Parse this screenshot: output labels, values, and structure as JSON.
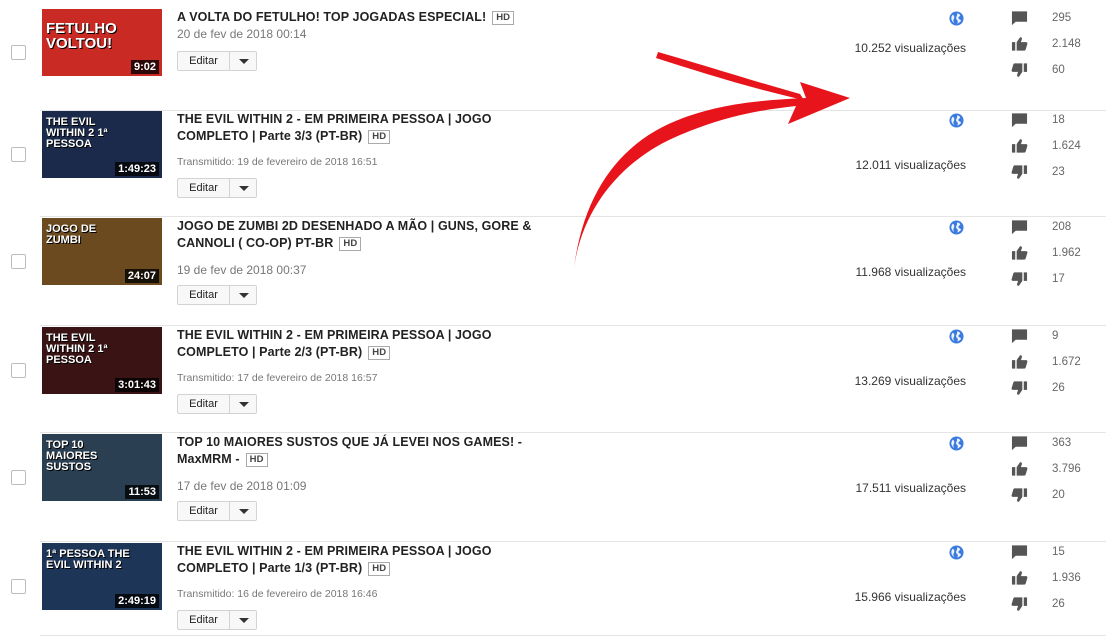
{
  "videos": [
    {
      "title": "A VOLTA DO FETULHO! TOP JOGADAS ESPECIAL!",
      "hd": "HD",
      "date": "20 de fev de 2018 00:14",
      "edit_label": "Editar",
      "views": "10.252 visualizações",
      "comments": "295",
      "likes": "2.148",
      "dislikes": "60",
      "thumb": {
        "duration": "9:02",
        "text": "FETULHO VOLTOU!",
        "bg": "#c92a24"
      }
    },
    {
      "title": "THE EVIL WITHIN 2 - EM PRIMEIRA PESSOA | JOGO COMPLETO | Parte 3/3 (PT-BR)",
      "hd": "HD",
      "date": "Transmitido: 19 de fevereiro de 2018 16:51",
      "edit_label": "Editar",
      "views": "12.011 visualizações",
      "comments": "18",
      "likes": "1.624",
      "dislikes": "23",
      "thumb": {
        "duration": "1:49:23",
        "text": "THE EVIL WITHIN 2 1ª PESSOA",
        "bg": "#1b2a4a"
      }
    },
    {
      "title": "JOGO DE ZUMBI 2D DESENHADO A MÃO | GUNS, GORE & CANNOLI ( CO-OP) PT-BR",
      "hd": "HD",
      "date": "19 de fev de 2018 00:37",
      "edit_label": "Editar",
      "views": "11.968 visualizações",
      "comments": "208",
      "likes": "1.962",
      "dislikes": "17",
      "thumb": {
        "duration": "24:07",
        "text": "JOGO DE ZUMBI",
        "bg": "#6b4a1f"
      }
    },
    {
      "title": "THE EVIL WITHIN 2 - EM PRIMEIRA PESSOA | JOGO COMPLETO | Parte 2/3 (PT-BR)",
      "hd": "HD",
      "date": "Transmitido: 17 de fevereiro de 2018 16:57",
      "edit_label": "Editar",
      "views": "13.269 visualizações",
      "comments": "9",
      "likes": "1.672",
      "dislikes": "26",
      "thumb": {
        "duration": "3:01:43",
        "text": "THE EVIL WITHIN 2 1ª PESSOA",
        "bg": "#3a1414"
      }
    },
    {
      "title": "TOP 10 MAIORES SUSTOS QUE JÁ LEVEI NOS GAMES! - MaxMRM -",
      "hd": "HD",
      "date": "17 de fev de 2018 01:09",
      "edit_label": "Editar",
      "views": "17.511 visualizações",
      "comments": "363",
      "likes": "3.796",
      "dislikes": "20",
      "thumb": {
        "duration": "11:53",
        "text": "TOP 10 MAIORES SUSTOS",
        "bg": "#2b3f52"
      }
    },
    {
      "title": "THE EVIL WITHIN 2 - EM PRIMEIRA PESSOA | JOGO COMPLETO | Parte 1/3 (PT-BR)",
      "hd": "HD",
      "date": "Transmitido: 16 de fevereiro de 2018 16:46",
      "edit_label": "Editar",
      "views": "15.966 visualizações",
      "comments": "15",
      "likes": "1.936",
      "dislikes": "26",
      "thumb": {
        "duration": "2:49:19",
        "text": "1ª PESSOA THE EVIL WITHIN 2",
        "bg": "#1d3556"
      }
    }
  ],
  "colors": {
    "globe": "#3b7be0",
    "arrow": "#e8141b",
    "icon": "#555555"
  }
}
